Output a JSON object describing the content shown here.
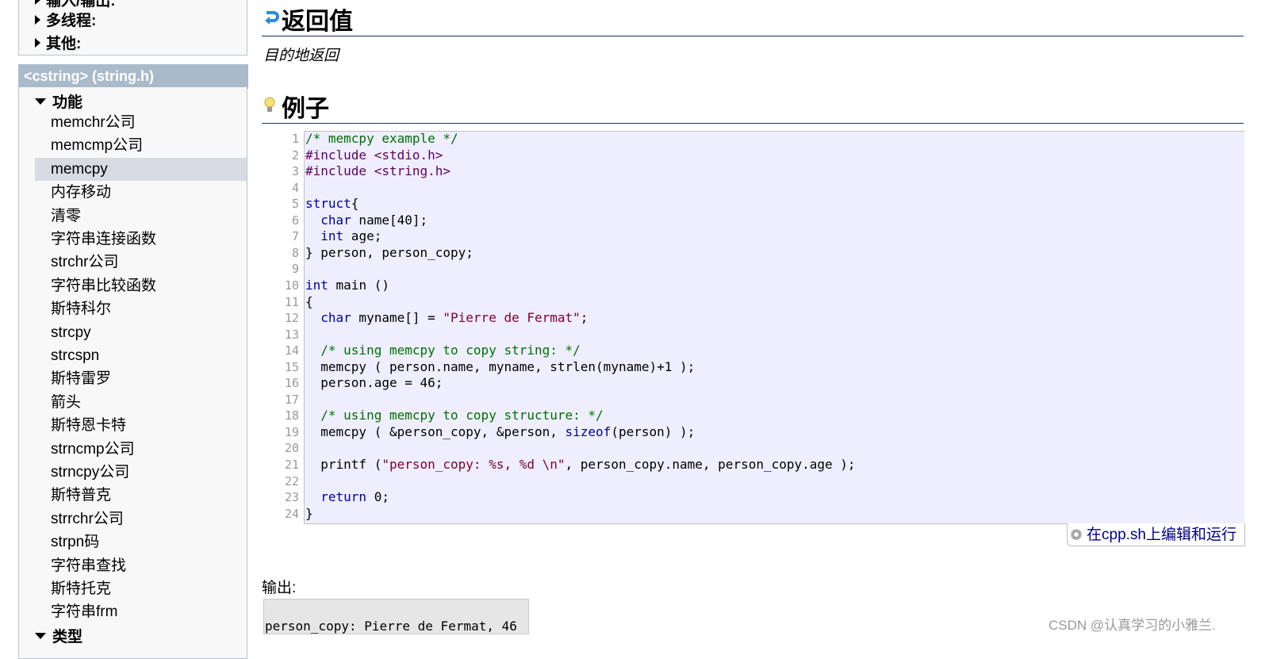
{
  "sidebar": {
    "top_categories": [
      {
        "label": "输入/输出:"
      },
      {
        "label": "多线程:"
      },
      {
        "label": "其他:"
      }
    ],
    "header": "<cstring> (string.h)",
    "section_functions": "功能",
    "items": [
      "memchr公司",
      "memcmp公司",
      "memcpy",
      "内存移动",
      "清零",
      "字符串连接函数",
      "strchr公司",
      "字符串比较函数",
      "斯特科尔",
      "strcpy",
      "strcspn",
      "斯特雷罗",
      "箭头",
      "斯特恩卡特",
      "strncmp公司",
      "strncpy公司",
      "斯特普克",
      "strrchr公司",
      "strpn码",
      "字符串查找",
      "斯特托克",
      "字符串frm"
    ],
    "selected": "memcpy",
    "section_types": "类型"
  },
  "main": {
    "return_heading": "返回值",
    "return_text": "目的地返回",
    "example_heading": "例子",
    "code_lines": [
      [
        [
          "c",
          "/* memcpy example */"
        ]
      ],
      [
        [
          "p",
          "#include <stdio.h>"
        ]
      ],
      [
        [
          "p",
          "#include <string.h>"
        ]
      ],
      [],
      [
        [
          "k",
          "struct"
        ],
        [
          "",
          "{"
        ]
      ],
      [
        [
          "",
          "  "
        ],
        [
          "k",
          "char"
        ],
        [
          "",
          " name[40];"
        ]
      ],
      [
        [
          "",
          "  "
        ],
        [
          "k",
          "int"
        ],
        [
          "",
          " age;"
        ]
      ],
      [
        [
          "",
          "} person, person_copy;"
        ]
      ],
      [],
      [
        [
          "k",
          "int"
        ],
        [
          "",
          " main ()"
        ]
      ],
      [
        [
          "",
          "{"
        ]
      ],
      [
        [
          "",
          "  "
        ],
        [
          "k",
          "char"
        ],
        [
          "",
          " myname[] = "
        ],
        [
          "s",
          "\"Pierre de Fermat\""
        ],
        [
          "",
          ";"
        ]
      ],
      [],
      [
        [
          "",
          "  "
        ],
        [
          "c",
          "/* using memcpy to copy string: */"
        ]
      ],
      [
        [
          "",
          "  memcpy ( person.name, myname, strlen(myname)+1 );"
        ]
      ],
      [
        [
          "",
          "  person.age = 46;"
        ]
      ],
      [],
      [
        [
          "",
          "  "
        ],
        [
          "c",
          "/* using memcpy to copy structure: */"
        ]
      ],
      [
        [
          "",
          "  memcpy ( &person_copy, &person, "
        ],
        [
          "k",
          "sizeof"
        ],
        [
          "",
          "(person) );"
        ]
      ],
      [],
      [
        [
          "",
          "  printf ("
        ],
        [
          "s",
          "\"person_copy: %s, %d \\n\""
        ],
        [
          "",
          ", person_copy.name, person_copy.age );"
        ]
      ],
      [],
      [
        [
          "",
          "  "
        ],
        [
          "k",
          "return"
        ],
        [
          "",
          " 0;"
        ]
      ],
      [
        [
          "",
          "}"
        ]
      ]
    ],
    "run_button": "在cpp.sh上编辑和运行",
    "output_label": "输出:",
    "output_text": "person_copy: Pierre de Fermat, 46"
  },
  "watermark": "CSDN @认真学习的小雅兰."
}
